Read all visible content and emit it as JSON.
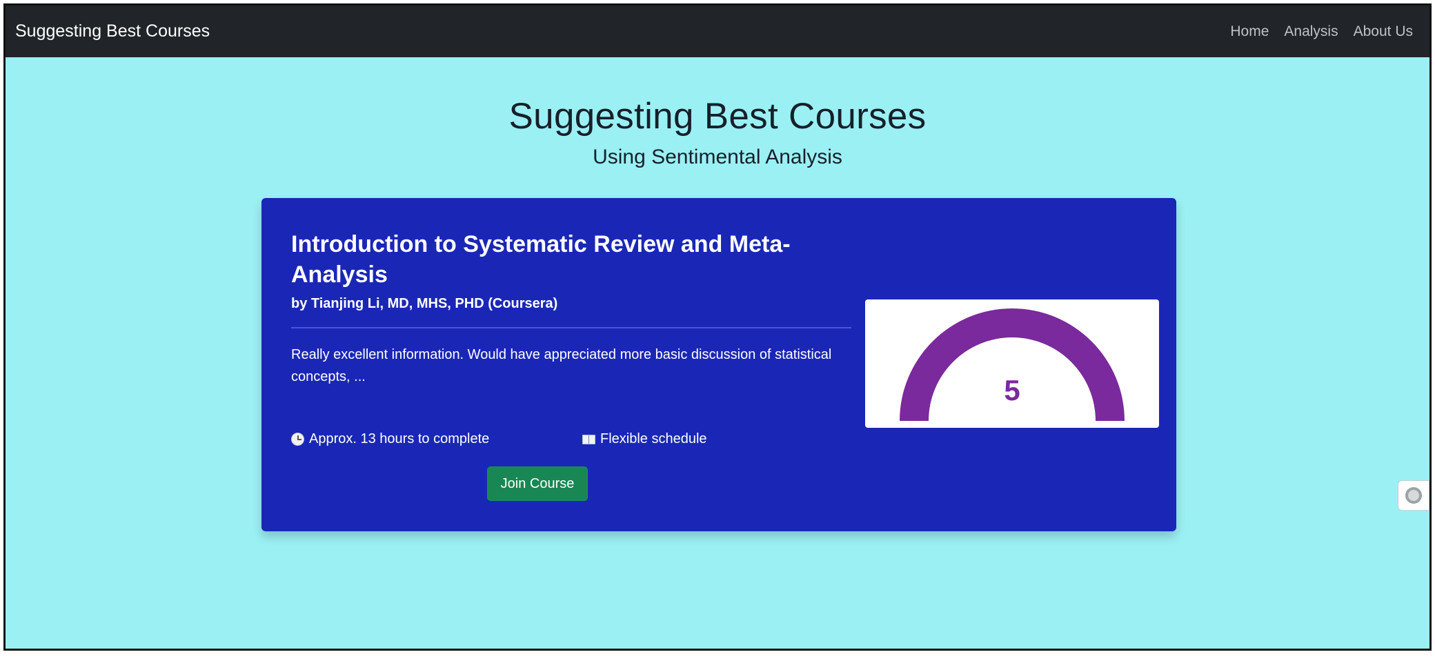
{
  "navbar": {
    "brand": "Suggesting Best Courses",
    "links": [
      "Home",
      "Analysis",
      "About Us"
    ]
  },
  "header": {
    "title": "Suggesting Best Courses",
    "subtitle": "Using Sentimental Analysis"
  },
  "course": {
    "title": "Introduction to Systematic Review and Meta-Analysis",
    "author": "by Tianjing Li, MD, MHS, PHD (Coursera)",
    "review": "Really excellent information. Would have appreciated more basic discussion of statistical concepts, ...",
    "duration": "Approx. 13 hours to complete",
    "duration_icon": "clock-icon",
    "schedule": "Flexible schedule",
    "schedule_icon": "book-icon",
    "join_label": "Join Course",
    "rating": {
      "value": "5",
      "max": 5,
      "gauge_color": "#7a2a9c"
    }
  },
  "colors": {
    "navbar_bg": "#212529",
    "page_bg": "#9bf0f4",
    "card_bg": "#1a27b6",
    "button_bg": "#198754"
  },
  "side_widget_icon": "circle-widget-icon"
}
